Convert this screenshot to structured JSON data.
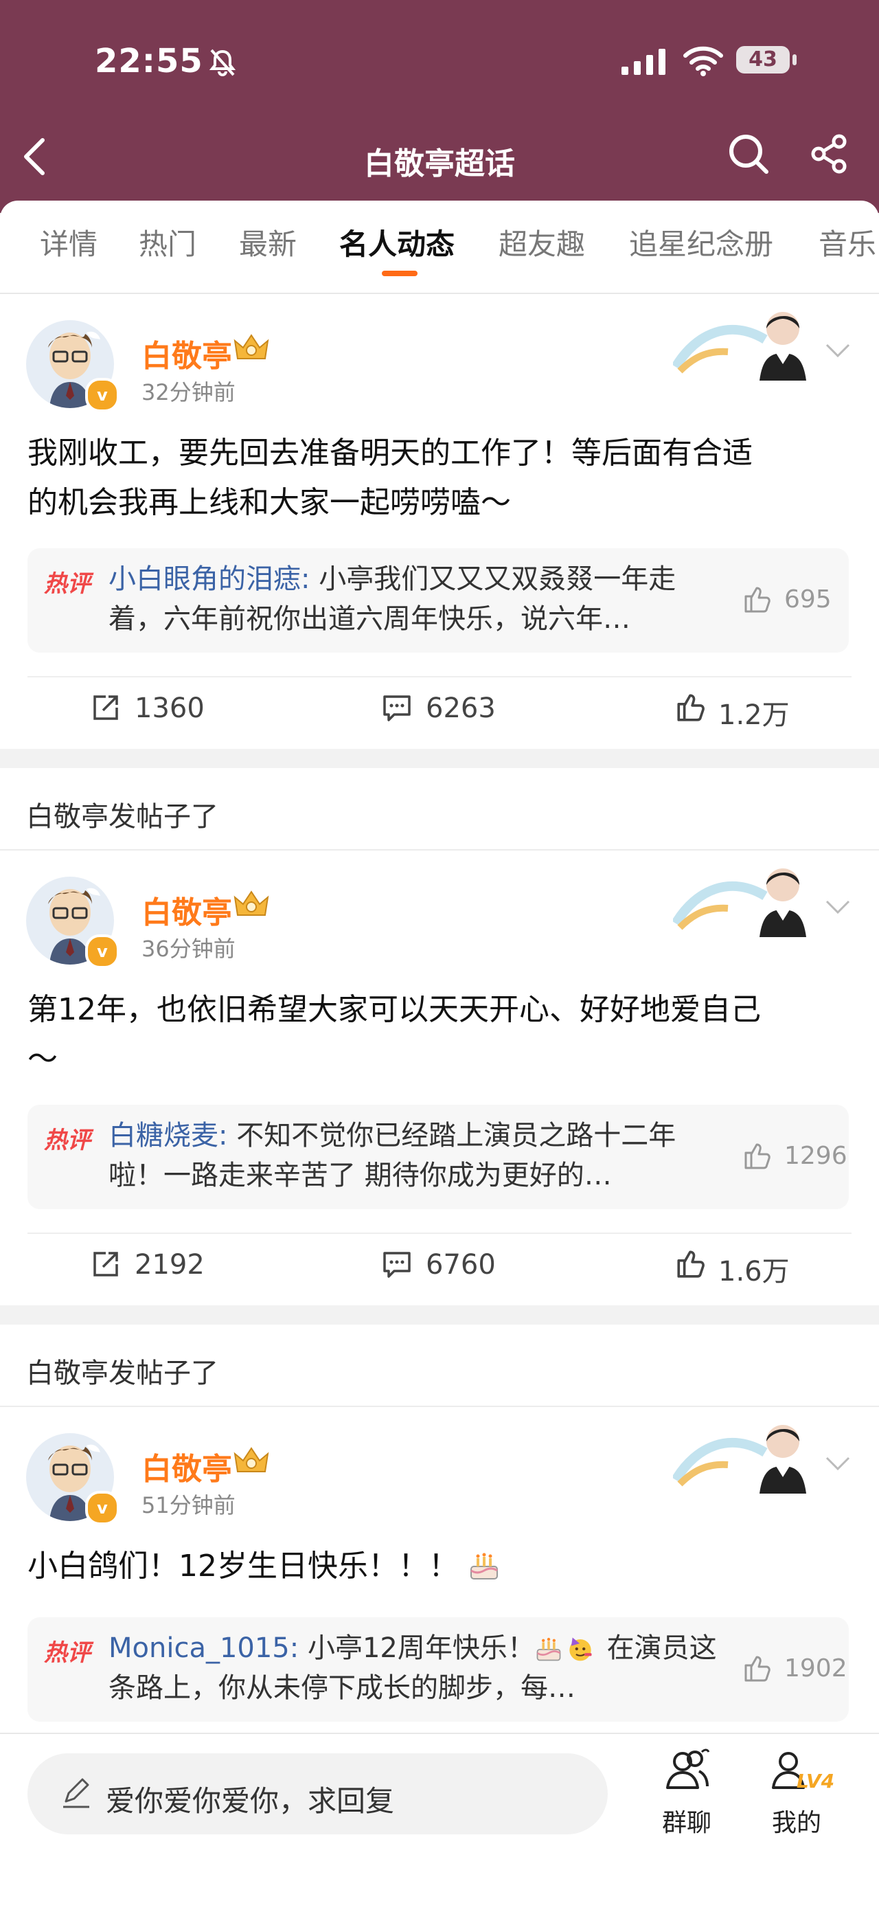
{
  "status_bar": {
    "time": "22:55",
    "battery": "43"
  },
  "nav": {
    "title": "白敬亭超话"
  },
  "tabs": [
    "详情",
    "热门",
    "最新",
    "名人动态",
    "超友趣",
    "追星纪念册",
    "音乐"
  ],
  "active_tab": "名人动态",
  "section_label": "白敬亭发帖子了",
  "posts": [
    {
      "author": "白敬亭",
      "time_ago": "32分钟前",
      "text_line1": "我刚收工，要先回去准备明天的工作了！等后面有合适",
      "text_line2": "的机会我再上线和大家一起唠唠嗑～",
      "hot_label": "热评",
      "hot_user": "小白眼角的泪痣:",
      "hot_text": " 小亭我们又又又双叒叕一年走着，六年前祝你出道六周年快乐，说六年…",
      "hot_likes": "695",
      "reposts": "1360",
      "comments": "6263",
      "likes": "1.2万"
    },
    {
      "author": "白敬亭",
      "time_ago": "36分钟前",
      "text_line1": "第12年，也依旧希望大家可以天天开心、好好地爱自己",
      "text_line2": "～",
      "hot_label": "热评",
      "hot_user": "白糖烧麦:",
      "hot_text": " 不知不觉你已经踏上演员之路十二年啦！一路走来辛苦了 期待你成为更好的…",
      "hot_likes": "1296",
      "reposts": "2192",
      "comments": "6760",
      "likes": "1.6万"
    },
    {
      "author": "白敬亭",
      "time_ago": "51分钟前",
      "text_line1": "小白鸽们！12岁生日快乐！！！",
      "hot_label": "热评",
      "hot_user": "Monica_1015:",
      "hot_text_a": " 小亭12周年快乐！",
      "hot_text_b": " 在演员这条路上，你从未停下成长的脚步，每…",
      "hot_likes": "1902"
    }
  ],
  "bottom": {
    "reply_placeholder": "爱你爱你爱你，求回复",
    "group_chat": "群聊",
    "mine": "我的",
    "level": "LV4"
  },
  "colors": {
    "header": "#7a3a52",
    "accent": "#ff6a16",
    "author": "#ff7a1a",
    "hot_tag": "#f04848",
    "hot_user": "#3b63a6"
  }
}
